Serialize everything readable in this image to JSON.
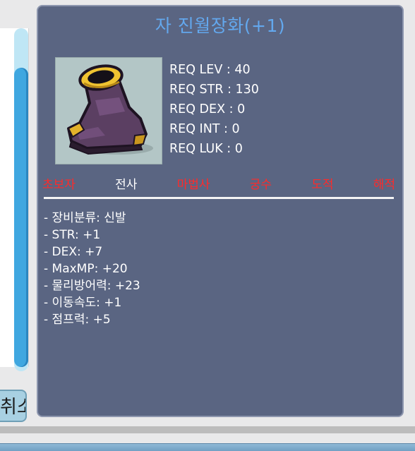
{
  "tooltip": {
    "title": "자 진월장화(+1)",
    "title_color": "#63a8ee",
    "background_color": "#5a6582",
    "icon": "boots-icon",
    "requirements": [
      {
        "label": "REQ LEV : 40"
      },
      {
        "label": "REQ STR : 130"
      },
      {
        "label": "REQ DEX : 0"
      },
      {
        "label": "REQ INT : 0"
      },
      {
        "label": "REQ LUK : 0"
      }
    ],
    "jobs": [
      {
        "label": "초보자",
        "color": "#ff2a2a"
      },
      {
        "label": "전사",
        "color": "#ffffff"
      },
      {
        "label": "마법사",
        "color": "#ff2a2a"
      },
      {
        "label": "궁수",
        "color": "#ff2a2a"
      },
      {
        "label": "도적",
        "color": "#ff2a2a"
      },
      {
        "label": "해적",
        "color": "#ff2a2a"
      }
    ],
    "stats": [
      "- 장비분류: 신발",
      "- STR: +1",
      "- DEX: +7",
      "- MaxMP: +20",
      "- 물리방어력: +23",
      "- 이동속도: +1",
      "- 점프력: +5"
    ]
  },
  "background": {
    "cancel_button_label": "취소"
  }
}
